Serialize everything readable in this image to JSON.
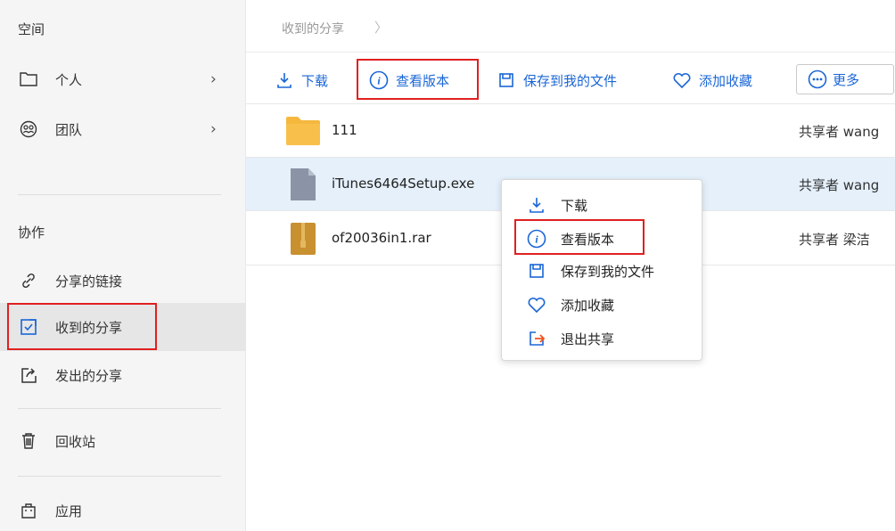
{
  "sidebar": {
    "header": "空间",
    "items": [
      {
        "label": "个人",
        "icon": "folder-icon"
      },
      {
        "label": "团队",
        "icon": "team-icon"
      }
    ],
    "collab_header": "协作",
    "collab_items": [
      {
        "label": "分享的链接",
        "icon": "link-icon"
      },
      {
        "label": "收到的分享",
        "icon": "received-share-icon"
      },
      {
        "label": "发出的分享",
        "icon": "sent-share-icon"
      }
    ],
    "trash": {
      "label": "回收站",
      "icon": "trash-icon"
    },
    "apps": {
      "label": "应用",
      "icon": "bag-icon"
    }
  },
  "breadcrumb": {
    "current": "收到的分享"
  },
  "toolbar": {
    "download": "下载",
    "view_version": "查看版本",
    "save_to_my_files": "保存到我的文件",
    "add_favorite": "添加收藏",
    "more": "更多"
  },
  "files": [
    {
      "name": "111",
      "owner": "共享者 wang",
      "type": "folder"
    },
    {
      "name": "iTunes6464Setup.exe",
      "owner": "共享者 wang",
      "type": "exe",
      "selected": true
    },
    {
      "name": "of20036in1.rar",
      "owner": "共享者 梁洁",
      "type": "rar"
    }
  ],
  "context_menu": {
    "items": [
      "下载",
      "查看版本",
      "保存到我的文件",
      "添加收藏",
      "退出共享"
    ]
  },
  "colors": {
    "accent": "#1a66d6",
    "highlight": "#e02020",
    "selected_row": "#e5f0fb",
    "folder": "#f5b83d"
  }
}
